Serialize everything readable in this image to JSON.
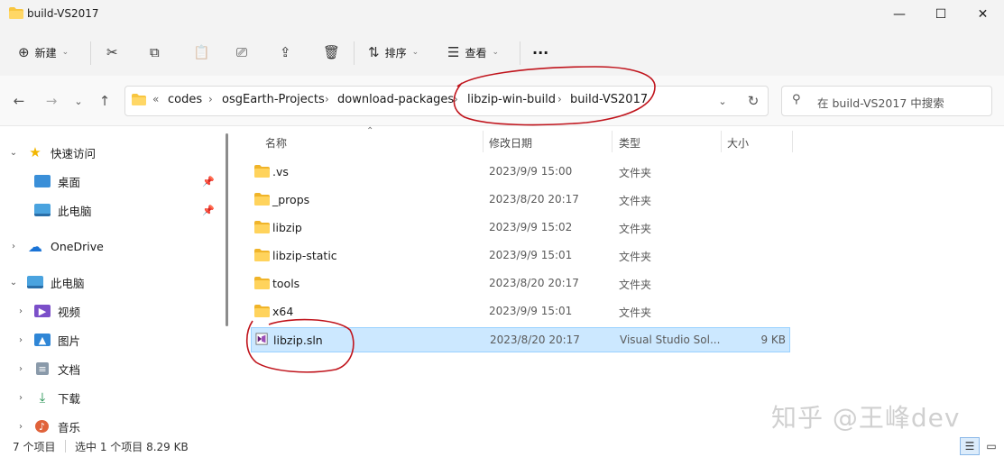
{
  "window": {
    "title": "build-VS2017",
    "minimize_glyph": "—",
    "maximize_glyph": "☐",
    "close_glyph": "✕"
  },
  "toolbar": {
    "new_label": "新建",
    "sort_label": "排序",
    "view_label": "查看",
    "more_label": "···"
  },
  "address": {
    "prefix": "«",
    "breadcrumbs": [
      "codes",
      "osgEarth-Projects",
      "download-packages",
      "libzip-win-build",
      "build-VS2017"
    ],
    "separator": "›"
  },
  "search": {
    "placeholder": "在 build-VS2017 中搜索"
  },
  "sidebar": {
    "items": [
      {
        "label": "快速访问",
        "icon": "star-icon"
      },
      {
        "label": "桌面",
        "icon": "desktop-icon"
      },
      {
        "label": "此电脑",
        "icon": "computer-icon"
      },
      {
        "label": "OneDrive",
        "icon": "cloud-icon"
      },
      {
        "label": "此电脑",
        "icon": "computer-icon"
      },
      {
        "label": "视频",
        "icon": "video-icon"
      },
      {
        "label": "图片",
        "icon": "picture-icon"
      },
      {
        "label": "文档",
        "icon": "document-icon"
      },
      {
        "label": "下载",
        "icon": "download-icon"
      },
      {
        "label": "音乐",
        "icon": "music-icon"
      }
    ]
  },
  "columns": {
    "name": "名称",
    "modified": "修改日期",
    "type": "类型",
    "size": "大小"
  },
  "files": [
    {
      "name": ".vs",
      "modified": "2023/9/9 15:00",
      "type": "文件夹",
      "size": ""
    },
    {
      "name": "_props",
      "modified": "2023/8/20 20:17",
      "type": "文件夹",
      "size": ""
    },
    {
      "name": "libzip",
      "modified": "2023/9/9 15:02",
      "type": "文件夹",
      "size": ""
    },
    {
      "name": "libzip-static",
      "modified": "2023/9/9 15:01",
      "type": "文件夹",
      "size": ""
    },
    {
      "name": "tools",
      "modified": "2023/8/20 20:17",
      "type": "文件夹",
      "size": ""
    },
    {
      "name": "x64",
      "modified": "2023/9/9 15:01",
      "type": "文件夹",
      "size": ""
    },
    {
      "name": "libzip.sln",
      "modified": "2023/8/20 20:17",
      "type": "Visual Studio Sol...",
      "size": "9 KB"
    }
  ],
  "status": {
    "count": "7 个项目",
    "selection": "选中 1 个项目  8.29 KB"
  },
  "watermark": "知乎 @王峰dev",
  "colors": {
    "accent": "#0067c0",
    "folder": "#f8c640",
    "selection_bg": "#cce8ff",
    "annotation_red": "#c0141c"
  }
}
